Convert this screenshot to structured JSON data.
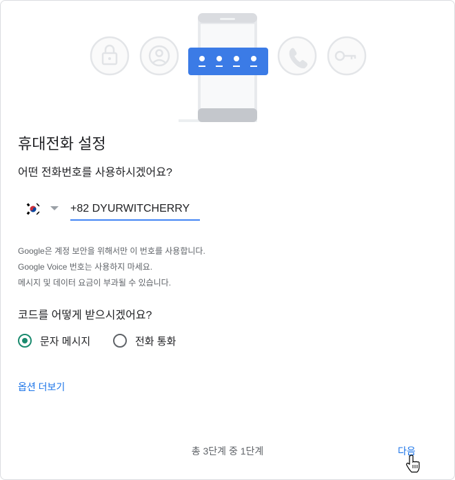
{
  "header": {
    "title": "휴대전화 설정",
    "question": "어떤 전화번호를 사용하시겠어요?"
  },
  "phone": {
    "country": "KR",
    "value": "+82 DYURWITCHERRY"
  },
  "notes": [
    "Google은 계정 보안을 위해서만 이 번호를 사용합니다.",
    "Google Voice 번호는 사용하지 마세요.",
    "메시지 및 데이터 요금이 부과될 수 있습니다."
  ],
  "method": {
    "question": "코드를 어떻게 받으시겠어요?",
    "options": [
      {
        "label": "문자 메시지",
        "checked": true
      },
      {
        "label": "전화 통화",
        "checked": false
      }
    ]
  },
  "more_options": "옵션 더보기",
  "footer": {
    "steps": "총 3단계 중 1단계",
    "next": "다음"
  },
  "colors": {
    "accent": "#1a73e8",
    "radio": "#1a8a6e",
    "pin_card": "#3b7be6"
  },
  "icons": [
    "lock-icon",
    "account-icon",
    "pin-dots-icon",
    "phone-icon",
    "key-icon"
  ]
}
